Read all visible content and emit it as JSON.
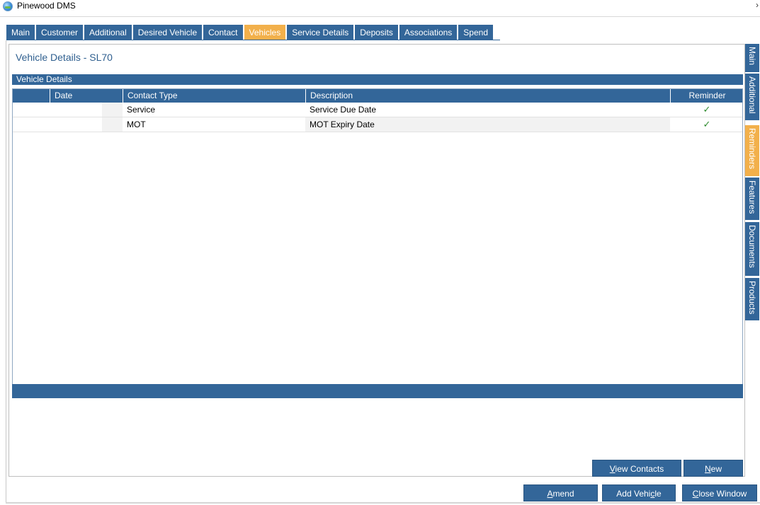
{
  "window": {
    "title": "Pinewood DMS",
    "chevron": "›"
  },
  "top_tabs": [
    {
      "label": "Main",
      "active": false
    },
    {
      "label": "Customer",
      "active": false
    },
    {
      "label": "Additional",
      "active": false
    },
    {
      "label": "Desired Vehicle",
      "active": false
    },
    {
      "label": "Contact",
      "active": false
    },
    {
      "label": "Vehicles",
      "active": true
    },
    {
      "label": "Service Details",
      "active": false
    },
    {
      "label": "Deposits",
      "active": false
    },
    {
      "label": "Associations",
      "active": false
    },
    {
      "label": "Spend",
      "active": false
    }
  ],
  "panel": {
    "title": "Vehicle Details - SL70",
    "section_header": "Vehicle Details"
  },
  "grid": {
    "columns": [
      "Date",
      "Contact Type",
      "Description",
      "Reminder"
    ],
    "rows": [
      {
        "date": "",
        "contact_type": "Service",
        "description": "Service Due Date",
        "reminder": "✓"
      },
      {
        "date": "",
        "contact_type": "MOT",
        "description": "MOT Expiry Date",
        "reminder": "✓"
      }
    ]
  },
  "side_tabs": [
    {
      "label": "Main",
      "active": false
    },
    {
      "label": "Additional",
      "active": false
    },
    {
      "label": "Reminders",
      "active": true
    },
    {
      "label": "Features",
      "active": false
    },
    {
      "label": "Documents",
      "active": false
    },
    {
      "label": "Products",
      "active": false
    }
  ],
  "buttons": {
    "view_contacts": {
      "accel": "V",
      "rest": "iew Contacts"
    },
    "new": {
      "accel": "N",
      "rest": "ew"
    },
    "amend": {
      "accel": "A",
      "rest": "mend"
    },
    "add_vehicle": {
      "pre": "Add Vehi",
      "accel": "c",
      "rest": "le"
    },
    "close_window": {
      "accel": "C",
      "rest": "lose Window"
    }
  },
  "colors": {
    "accent": "#336699",
    "active_tab": "#f2b04b",
    "title_text": "#2f5f8f",
    "tick": "#2e8b2e"
  }
}
